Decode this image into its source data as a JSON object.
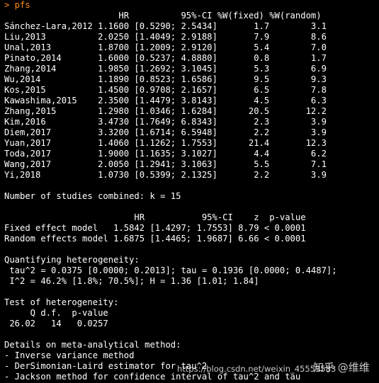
{
  "console": {
    "prompt": "> pfs",
    "table_header": "                      HR          95%-CI %W(fixed) %W(random)",
    "table_rows": [
      "Sánchez-Lara,2012 1.1600 [0.5290; 2.5434]       1.7        3.1",
      "Liu,2013          2.0250 [1.4049; 2.9188]       7.9        8.6",
      "Unal,2013         1.8700 [1.2009; 2.9120]       5.4        7.0",
      "Pinato,2014       1.6000 [0.5237; 4.8880]       0.8        1.7",
      "Zhang,2014        1.9850 [1.2692; 3.1045]       5.3        6.9",
      "Wu,2014           1.1890 [0.8523; 1.6586]       9.5        9.3",
      "Kos,2015          1.4500 [0.9708; 2.1657]       6.5        7.8",
      "Kawashima,2015    2.3500 [1.4479; 3.8143]       4.5        6.3",
      "Zhang,2015        1.2980 [1.0346; 1.6284]      20.5       12.2",
      "Kim,2016          3.4730 [1.7649; 6.8343]       2.3        3.9",
      "Diem,2017         3.3200 [1.6714; 6.5948]       2.2        3.9",
      "Yuan,2017         1.4060 [1.1262; 1.7553]      21.4       12.3",
      "Toda,2017         1.9000 [1.1635; 3.1027]       4.4        6.2",
      "Wang,2017         2.0050 [1.2941; 3.1063]       5.5        7.1",
      "Yi,2018           1.0730 [0.5399; 2.1325]       2.2        3.9"
    ],
    "studies_combined": "Number of studies combined: k = 15",
    "model_header": "                         HR           95%-CI    z  p-value",
    "fixed_model": "Fixed effect model   1.5842 [1.4297; 1.7553] 8.79 < 0.0001",
    "random_model": "Random effects model 1.6875 [1.4465; 1.9687] 6.66 < 0.0001",
    "heterogeneity_title": "Quantifying heterogeneity:",
    "tau_line": " tau^2 = 0.0375 [0.0000; 0.2013]; tau = 0.1936 [0.0000; 0.4487];",
    "i2_line": " I^2 = 46.2% [1.8%; 70.5%]; H = 1.36 [1.01; 1.84]",
    "test_title": "Test of heterogeneity:",
    "test_header": "     Q d.f.  p-value",
    "test_values": " 26.02   14   0.0257",
    "details_title": "Details on meta-analytical method:",
    "details_items": [
      "- Inverse variance method",
      "- DerSimonian-Laird estimator for tau^2",
      "- Jackson method for confidence interval of tau^2 and tau"
    ]
  },
  "watermarks": {
    "zhihu": "知乎 @维维",
    "url": "https://blog.csdn.net/weixin_45553583"
  },
  "colors": {
    "background": "#000000",
    "text": "#ffffff",
    "prompt": "#ff8c1a"
  }
}
